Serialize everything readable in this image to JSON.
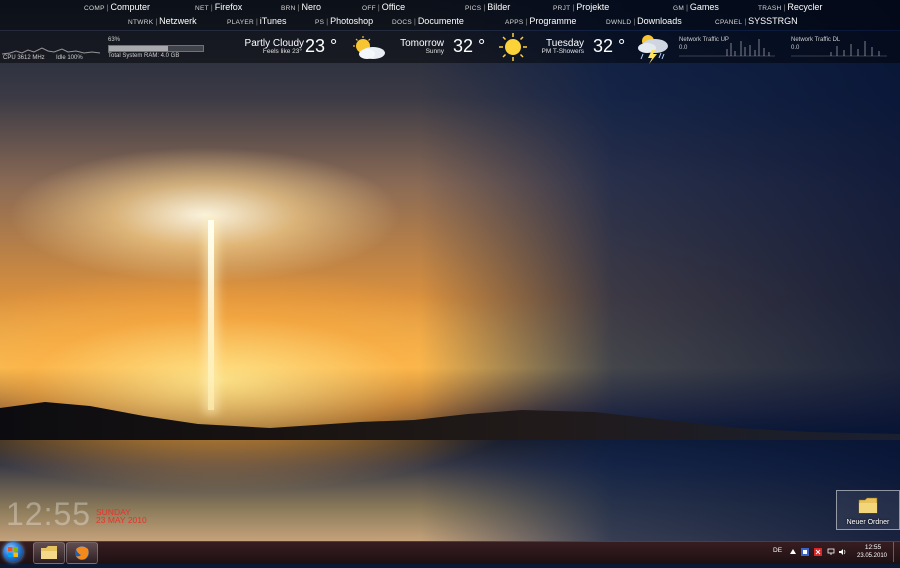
{
  "launcher": {
    "row1": [
      {
        "code": "COMP",
        "name": "Computer"
      },
      {
        "code": "NET",
        "name": "Firefox"
      },
      {
        "code": "BRN",
        "name": "Nero"
      },
      {
        "code": "OFF",
        "name": "Office"
      },
      {
        "code": "PICS",
        "name": "Bilder"
      },
      {
        "code": "PRJT",
        "name": "Projekte"
      },
      {
        "code": "GM",
        "name": "Games"
      },
      {
        "code": "TRASH",
        "name": "Recycler"
      }
    ],
    "row2": [
      {
        "code": "NTWRK",
        "name": "Netzwerk"
      },
      {
        "code": "PLAYER",
        "name": "iTunes"
      },
      {
        "code": "PS",
        "name": "Photoshop"
      },
      {
        "code": "DOCS",
        "name": "Documente"
      },
      {
        "code": "APPS",
        "name": "Programme"
      },
      {
        "code": "DWNLD",
        "name": "Downloads"
      },
      {
        "code": "CPANEL",
        "name": "SYSSTRGN"
      }
    ]
  },
  "system": {
    "cpu": "CPU 3612 MHz",
    "idle": "Idle 100%",
    "ram_percent_label": "63%",
    "ram_fraction": 0.63,
    "ram_total": "Total System RAM: 4.0 GB"
  },
  "weather": {
    "now": {
      "condition": "Partly Cloudy",
      "sub": "Feels like 23°",
      "temp": "23 °",
      "icon": "partly-cloudy-icon"
    },
    "tomorrow": {
      "condition": "Tomorrow",
      "sub": "Sunny",
      "temp": "32 °",
      "icon": "sun-icon"
    },
    "tuesday": {
      "condition": "Tuesday",
      "sub": "PM T-Showers",
      "temp": "32 °",
      "icon": "thunderstorm-icon"
    }
  },
  "network": {
    "up_label": "Network Traffic UP",
    "up_value": "0.0",
    "dl_label": "Network Traffic DL",
    "dl_value": "0.0"
  },
  "clock": {
    "time": "12:55",
    "day": "SUNDAY",
    "date": "23 MAY 2010"
  },
  "desktop": {
    "folder_label": "Neuer Ordner"
  },
  "taskbar": {
    "lang": "DE",
    "time": "12:55",
    "date": "23.05.2010"
  }
}
